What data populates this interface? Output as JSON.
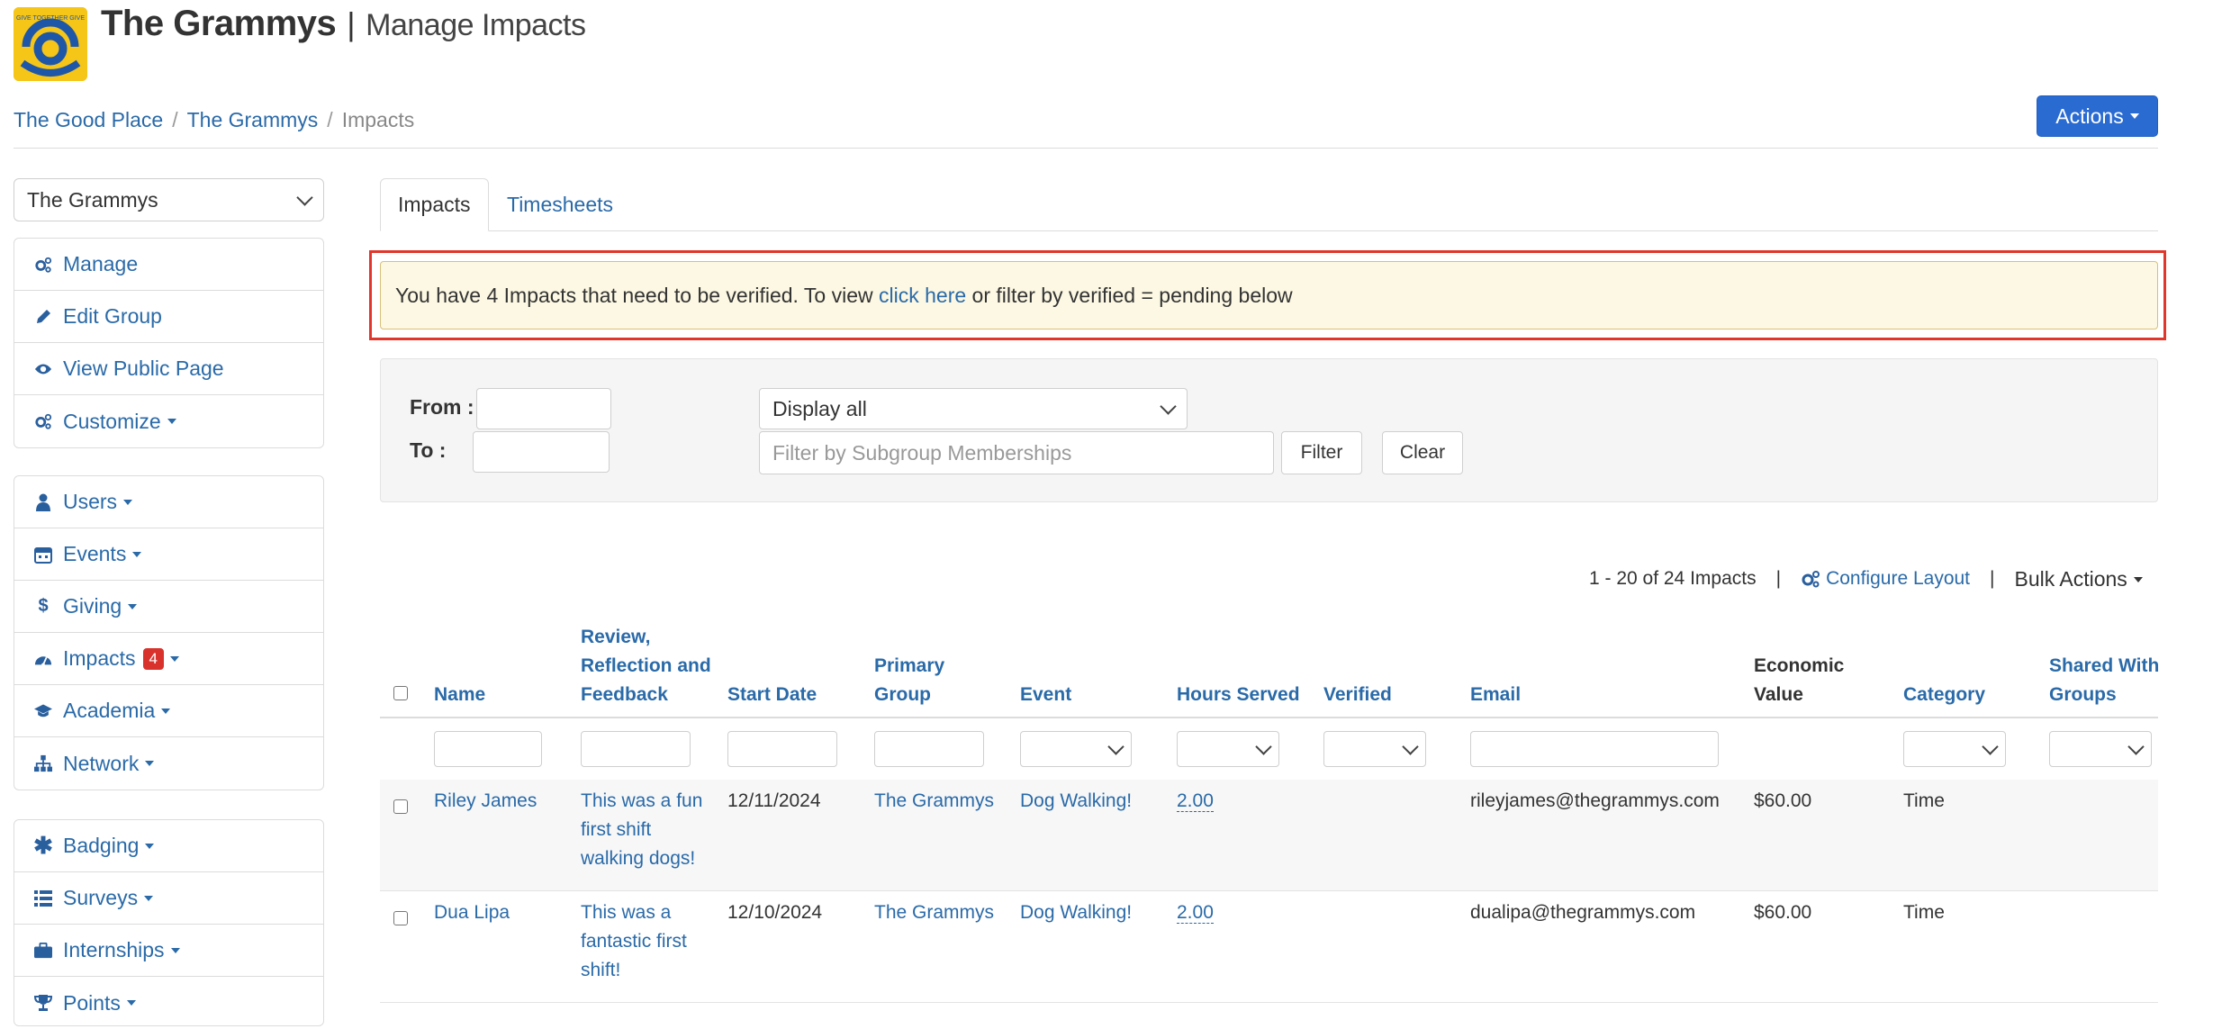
{
  "header": {
    "org_name": "The Grammys",
    "separator": "|",
    "page_title": "Manage Impacts",
    "logo_text": "GIVE TOGETHER GIVE"
  },
  "breadcrumb": {
    "items": [
      "The Good Place",
      "The Grammys",
      "Impacts"
    ],
    "divider": "/"
  },
  "actions_button": {
    "label": "Actions"
  },
  "sidebar": {
    "group_select": "The Grammys",
    "group1": [
      {
        "label": "Manage",
        "icon": "gears-icon"
      },
      {
        "label": "Edit Group",
        "icon": "pencil-icon"
      },
      {
        "label": "View Public Page",
        "icon": "eye-icon"
      },
      {
        "label": "Customize",
        "icon": "gears-icon"
      }
    ],
    "group2": [
      {
        "label": "Users",
        "icon": "user-icon"
      },
      {
        "label": "Events",
        "icon": "calendar-icon"
      },
      {
        "label": "Giving",
        "icon": "dollar-icon"
      },
      {
        "label": "Impacts",
        "icon": "dashboard-icon",
        "badge": "4"
      },
      {
        "label": "Academia",
        "icon": "graduation-cap-icon"
      },
      {
        "label": "Network",
        "icon": "sitemap-icon"
      }
    ],
    "group3": [
      {
        "label": "Badging",
        "icon": "asterisk-icon"
      },
      {
        "label": "Surveys",
        "icon": "list-icon"
      },
      {
        "label": "Internships",
        "icon": "briefcase-icon"
      },
      {
        "label": "Points",
        "icon": "trophy-icon"
      }
    ]
  },
  "tabs": [
    {
      "label": "Impacts",
      "active": true
    },
    {
      "label": "Timesheets",
      "active": false
    }
  ],
  "alert": {
    "prefix": "You have 4 Impacts that need to be verified. To view ",
    "link": "click here",
    "suffix": " or filter by verified = pending below",
    "highlight_color": "#e0362b"
  },
  "filter": {
    "from_label": "From :",
    "to_label": "To :",
    "from_value": "",
    "to_value": "",
    "display_select": "Display all",
    "subgroup_placeholder": "Filter by Subgroup Memberships",
    "filter_button": "Filter",
    "clear_button": "Clear"
  },
  "toolbar": {
    "count": "1 - 20 of 24 Impacts",
    "separator": "|",
    "configure_layout": "Configure Layout",
    "bulk_actions": "Bulk Actions"
  },
  "table": {
    "columns": [
      [
        "Name"
      ],
      [
        "Review,",
        "Reflection and",
        "Feedback"
      ],
      [
        "Start Date"
      ],
      [
        "Primary",
        "Group"
      ],
      [
        "Event"
      ],
      [
        "Hours Served"
      ],
      [
        "Verified"
      ],
      [
        "Email"
      ],
      [
        "Economic",
        "Value"
      ],
      [
        "Category"
      ],
      [
        "Shared With",
        "Groups"
      ]
    ],
    "rows": [
      {
        "name": "Riley James",
        "review": [
          "This was a fun",
          "first shift",
          "walking dogs!"
        ],
        "start_date": "12/11/2024",
        "primary_group": "The Grammys",
        "event": "Dog Walking!",
        "hours": "2.00",
        "verified": "",
        "email": "rileyjames@thegrammys.com",
        "economic_value": "$60.00",
        "category": "Time",
        "shared": ""
      },
      {
        "name": "Dua Lipa",
        "review": [
          "This was a",
          "fantastic first",
          "shift!"
        ],
        "start_date": "12/10/2024",
        "primary_group": "The Grammys",
        "event": "Dog Walking!",
        "hours": "2.00",
        "verified": "",
        "email": "dualipa@thegrammys.com",
        "economic_value": "$60.00",
        "category": "Time",
        "shared": ""
      }
    ]
  },
  "colors": {
    "link": "#2a6aa8",
    "primary_button": "#2a6bd2",
    "badge": "#d9322c",
    "alert_bg": "#fcf8e3"
  }
}
